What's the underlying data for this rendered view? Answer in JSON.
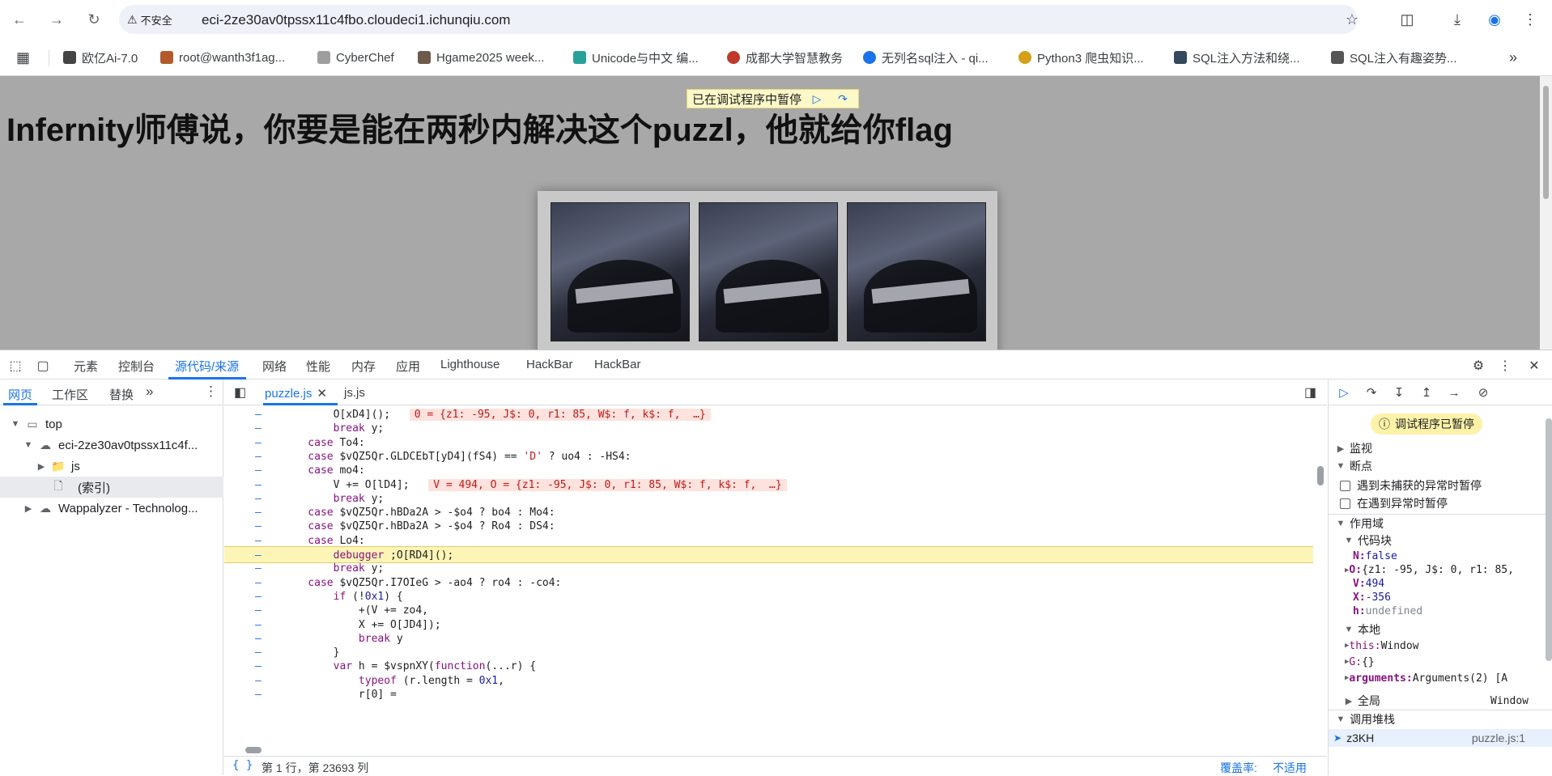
{
  "browser": {
    "security_label": "不安全",
    "url": "eci-2ze30av0tpssx11c4fbo.cloudeci1.ichunqiu.com",
    "bookmarks": [
      {
        "label": "欧亿Ai-7.0",
        "color": "#444"
      },
      {
        "label": "root@wanth3f1ag...",
        "color": "#b35a2b"
      },
      {
        "label": "CyberChef",
        "color": "#9e9e9e"
      },
      {
        "label": "Hgame2025 week...",
        "color": "#6d5a4a"
      },
      {
        "label": "Unicode与中文 编...",
        "color": "#2aa198"
      },
      {
        "label": "成都大学智慧教务",
        "color": "#c0392b"
      },
      {
        "label": "无列名sql注入 - qi...",
        "color": "#1a73e8"
      },
      {
        "label": "Python3 爬虫知识...",
        "color": "#d4a017"
      },
      {
        "label": "SQL注入方法和绕...",
        "color": "#34495e"
      },
      {
        "label": "SQL注入有趣姿势...",
        "color": "#555"
      }
    ]
  },
  "page": {
    "title": "Infernity师傅说，你要是能在两秒内解决这个puzzl，他就给你flag",
    "paused_banner": "已在调试程序中暂停"
  },
  "devtools": {
    "tabs": [
      "元素",
      "控制台",
      "源代码/来源",
      "网络",
      "性能",
      "内存",
      "应用",
      "Lighthouse",
      "HackBar",
      "HackBar"
    ],
    "active_tab": "源代码/来源",
    "nav_tabs": [
      "网页",
      "工作区",
      "替换"
    ],
    "tree": {
      "top": "top",
      "host": "eci-2ze30av0tpssx11c4f...",
      "js": "js",
      "index": "(索引)",
      "wappalyzer": "Wappalyzer - Technolog..."
    },
    "editor_tabs": [
      "puzzle.js",
      "js.js"
    ],
    "code_lines": [
      {
        "parts": [
          [
            "",
            "        O[xD4]();  "
          ],
          [
            "inl",
            "0 = {z1: -95, J$: 0, r1: 85, W$: f, k$: f,  …}"
          ]
        ]
      },
      {
        "parts": [
          [
            "kw",
            "        break"
          ],
          [
            "",
            " y;"
          ]
        ]
      },
      {
        "parts": [
          [
            "kw",
            "    case"
          ],
          [
            "",
            " To4:"
          ]
        ]
      },
      {
        "parts": [
          [
            "kw",
            "    case"
          ],
          [
            "",
            " $vQZ5Qr.GLDCEbT[yD4](fS4) == "
          ],
          [
            "str",
            "'D'"
          ],
          [
            "",
            " ? uo4 : -HS4:"
          ]
        ]
      },
      {
        "parts": [
          [
            "kw",
            "    case"
          ],
          [
            "",
            " mo4:"
          ]
        ]
      },
      {
        "parts": [
          [
            "",
            "        V += O[lD4];  "
          ],
          [
            "inl",
            "V = 494, O = {z1: -95, J$: 0, r1: 85, W$: f, k$: f,  …}"
          ]
        ]
      },
      {
        "parts": [
          [
            "kw",
            "        break"
          ],
          [
            "",
            " y;"
          ]
        ]
      },
      {
        "parts": [
          [
            "kw",
            "    case"
          ],
          [
            "",
            " $vQZ5Qr.hBDa2A > -$o4 ? bo4 : Mo4:"
          ]
        ]
      },
      {
        "parts": [
          [
            "kw",
            "    case"
          ],
          [
            "",
            " $vQZ5Qr.hBDa2A > -$o4 ? Ro4 : DS4:"
          ]
        ]
      },
      {
        "parts": [
          [
            "kw",
            "    case"
          ],
          [
            "",
            " Lo4:"
          ]
        ]
      },
      {
        "parts": [
          [
            "kw",
            "        debugger"
          ],
          [
            "",
            " ;O[RD4]();"
          ]
        ]
      },
      {
        "parts": [
          [
            "kw",
            "        break"
          ],
          [
            "",
            " y;"
          ]
        ]
      },
      {
        "parts": [
          [
            "kw",
            "    case"
          ],
          [
            "",
            " $vQZ5Qr.I7OIeG > -ao4 ? ro4 : -co4:"
          ]
        ]
      },
      {
        "parts": [
          [
            "kw",
            "        if"
          ],
          [
            "",
            " (!"
          ],
          [
            "num",
            "0x1"
          ],
          [
            "",
            ") {"
          ]
        ]
      },
      {
        "parts": [
          [
            "",
            "            +(V += zo4,"
          ]
        ]
      },
      {
        "parts": [
          [
            "",
            "            X += O[JD4]);"
          ]
        ]
      },
      {
        "parts": [
          [
            "kw",
            "            break"
          ],
          [
            "",
            " y"
          ]
        ]
      },
      {
        "parts": [
          [
            "",
            "        }"
          ]
        ]
      },
      {
        "parts": [
          [
            "kw",
            "        var"
          ],
          [
            "",
            " h = $vspnXY("
          ],
          [
            "kw",
            "function"
          ],
          [
            "",
            "(...r) {"
          ]
        ]
      },
      {
        "parts": [
          [
            "kw",
            "            typeof"
          ],
          [
            "",
            " (r.length = "
          ],
          [
            "num",
            "0x1"
          ],
          [
            "",
            ","
          ]
        ]
      },
      {
        "parts": [
          [
            "",
            "            r[0] ="
          ]
        ]
      }
    ],
    "status": {
      "position": "第 1 行，第 23693 列",
      "coverage_label": "覆盖率:",
      "coverage_value": "不适用"
    },
    "debugger": {
      "paused_pill": "调试程序已暂停",
      "sections": {
        "watch": "监视",
        "breakpoints": "断点",
        "pause_uncaught": "遇到未捕获的异常时暂停",
        "pause_caught": "在遇到异常时暂停",
        "scope": "作用域",
        "block": "代码块",
        "local": "本地",
        "global": "全局",
        "global_value": "Window",
        "callstack": "调用堆栈"
      },
      "block_vars": [
        {
          "name": "N",
          "value": "false",
          "kind": "num",
          "expand": false
        },
        {
          "name": "O",
          "value": "{z1: -95, J$: 0, r1: 85,",
          "kind": "obj",
          "expand": true
        },
        {
          "name": "V",
          "value": "494",
          "kind": "num",
          "expand": false
        },
        {
          "name": "X",
          "value": "-356",
          "kind": "num",
          "expand": false
        },
        {
          "name": "h",
          "value": "undefined",
          "kind": "undef",
          "expand": false
        }
      ],
      "local_vars": [
        {
          "name": "this",
          "value": "Window"
        },
        {
          "name": "G",
          "value": "{}"
        },
        {
          "name": "arguments",
          "value": "Arguments(2)  [A"
        }
      ],
      "callstack_top": {
        "fn": "z3KH",
        "loc": "puzzle.js:1"
      }
    }
  }
}
